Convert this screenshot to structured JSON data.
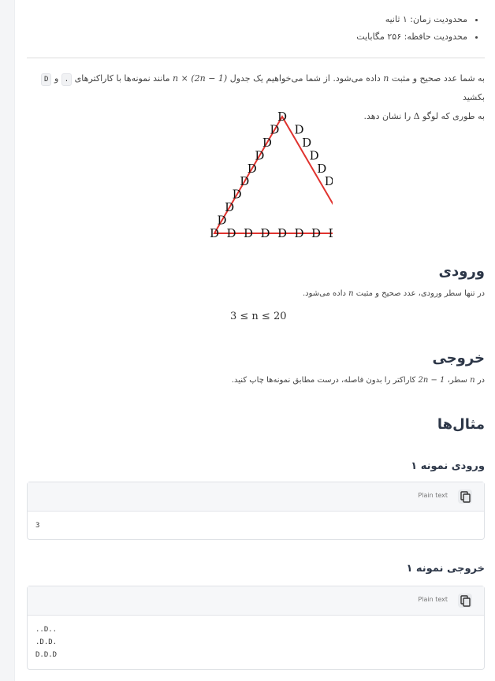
{
  "limits": [
    "محدودیت زمان: ۱ ثانیه",
    "محدودیت حافظه: ۲۵۶ مگابایت"
  ],
  "statement": {
    "part1": "به شما عدد صحیح و مثبت ",
    "n": "n",
    "part2": " داده می‌شود. از شما می‌خواهیم یک جدول ",
    "dims": "n × (2n − 1)",
    "part3": " مانند نمونه‌ها با کاراکترهای ",
    "char1": ".",
    "and": " و ",
    "char2": "D",
    "part4": " بکشید",
    "line2_part1": "به طوری که لوگو ",
    "delta": "Δ",
    "line2_part2": " را نشان دهد."
  },
  "triangle": {
    "letter": "D",
    "color": "#e0332f"
  },
  "input_section": {
    "title": "ورودی",
    "text1": "در تنها سطر ورودی، عدد صحیح و مثبت ",
    "n": "n",
    "text2": " داده می‌شود.",
    "constraint": "3 ≤ n ≤ 20"
  },
  "output_section": {
    "title": "خروجی",
    "text1": "در ",
    "n": "n",
    "text2": " سطر، ",
    "expr": "2n − 1",
    "text3": " کاراکتر را بدون فاصله، درست مطابق نمونه‌ها چاپ کنید."
  },
  "examples": {
    "title": "مثال‌ها",
    "sample_input": {
      "title": "ورودی نمونه ۱",
      "lang": "Plain text",
      "content": "3"
    },
    "sample_output": {
      "title": "خروجی نمونه ۱",
      "lang": "Plain text",
      "content": "..D..\n.D.D.\nD.D.D"
    }
  }
}
